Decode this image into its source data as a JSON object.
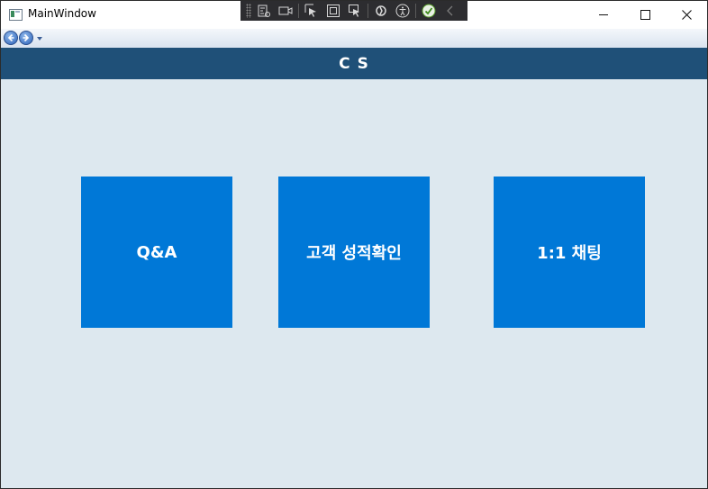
{
  "window": {
    "title": "MainWindow"
  },
  "header": {
    "title": "C S"
  },
  "tiles": [
    {
      "label": "Q&A"
    },
    {
      "label": "고객 성적확인"
    },
    {
      "label": "1:1 채팅"
    }
  ],
  "colors": {
    "header_bg": "#1f5078",
    "tile_bg": "#0078d7",
    "content_bg": "#dde8ef"
  },
  "icons": {
    "debug_toolbar": [
      "live-visual-tree-icon",
      "camera-icon",
      "select-element-icon",
      "display-layout-adorners-icon",
      "track-focus-icon",
      "hot-reload-icon",
      "accessibility-icon",
      "binding-ok-icon",
      "collapse-icon"
    ],
    "navigation": [
      "back-icon",
      "forward-icon",
      "history-dropdown-icon"
    ]
  }
}
